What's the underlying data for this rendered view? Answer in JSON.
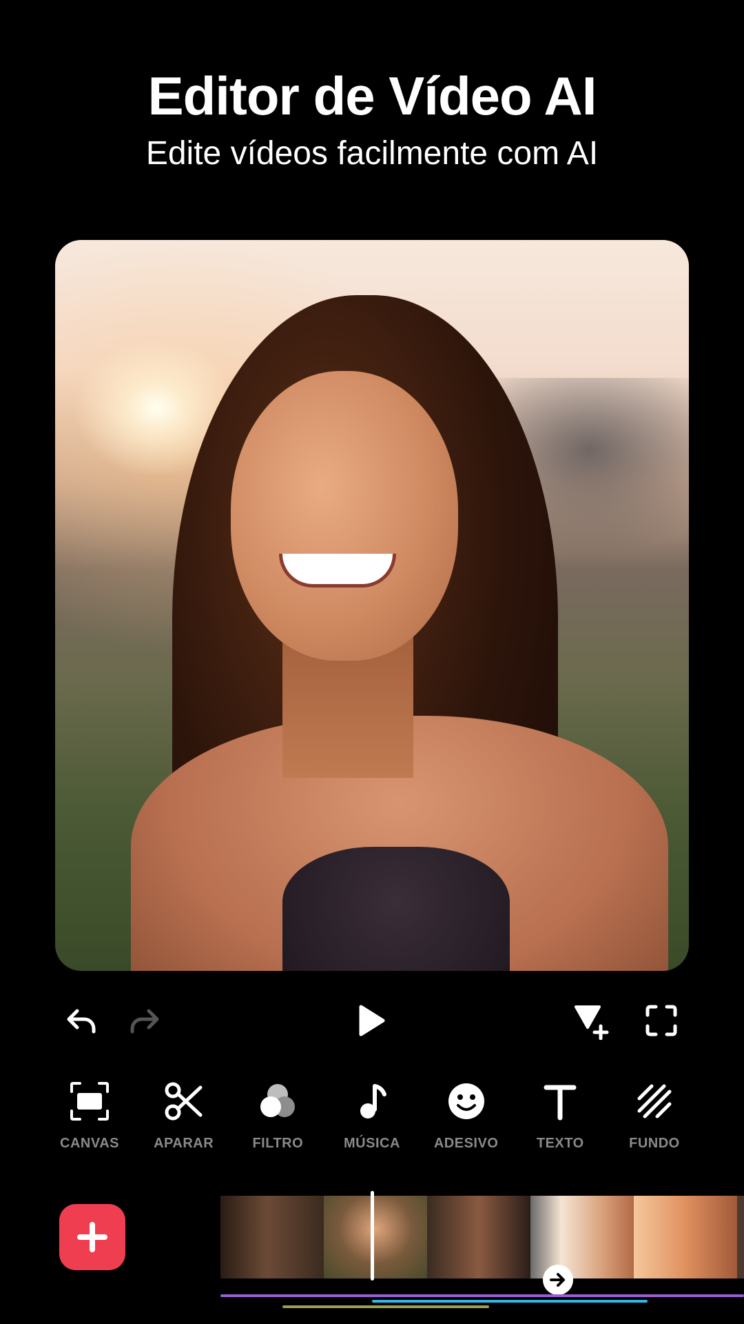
{
  "header": {
    "title": "Editor de Vídeo AI",
    "subtitle": "Edite vídeos facilmente com AI"
  },
  "playback": {
    "undo_icon": "undo-icon",
    "redo_icon": "redo-icon",
    "play_icon": "play-icon",
    "add_keyframe_icon": "keyframe-add-icon",
    "fullscreen_icon": "fullscreen-icon"
  },
  "tools": [
    {
      "label": "CANVAS",
      "icon": "canvas-icon"
    },
    {
      "label": "APARAR",
      "icon": "scissors-icon"
    },
    {
      "label": "FILTRO",
      "icon": "filter-icon"
    },
    {
      "label": "MÚSICA",
      "icon": "music-note-icon"
    },
    {
      "label": "ADESIVO",
      "icon": "sticker-icon"
    },
    {
      "label": "TEXTO",
      "icon": "text-icon"
    },
    {
      "label": "FUNDO",
      "icon": "background-icon"
    }
  ],
  "colors": {
    "accent_red": "#ef3e50",
    "track_purple": "#9a5fd0",
    "track_blue": "#34b6e6",
    "track_olive": "#9aa04e",
    "tool_label": "#8a8a8a"
  }
}
